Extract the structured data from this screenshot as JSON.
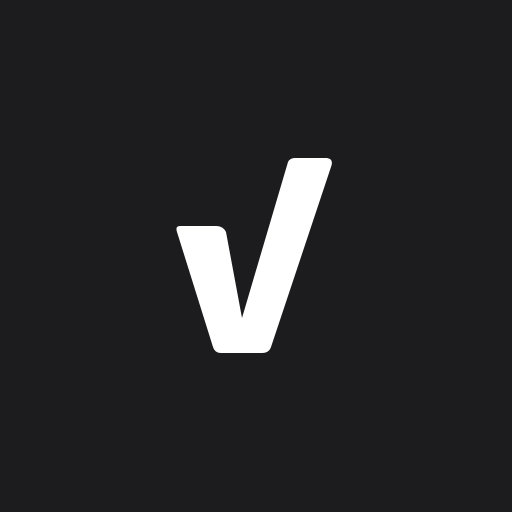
{
  "icon": {
    "background_color": "#1c1c1e",
    "glyph_color": "#ffffff",
    "glyph": "check-mark-icon"
  }
}
